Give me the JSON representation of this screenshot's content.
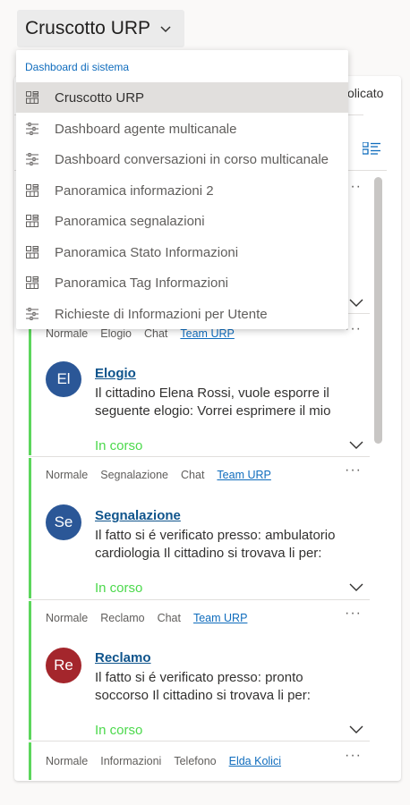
{
  "header": {
    "title": "Cruscotto URP"
  },
  "dropdown": {
    "section_label": "Dashboard di sistema",
    "items": [
      {
        "label": "Cruscotto URP",
        "icon": "grid-dashboard-icon",
        "selected": true
      },
      {
        "label": "Dashboard agente multicanale",
        "icon": "interactive-dashboard-icon"
      },
      {
        "label": "Dashboard conversazioni in corso multicanale",
        "icon": "interactive-dashboard-icon"
      },
      {
        "label": "Panoramica informazioni 2",
        "icon": "grid-dashboard-icon"
      },
      {
        "label": "Panoramica segnalazioni",
        "icon": "grid-dashboard-icon"
      },
      {
        "label": "Panoramica Stato Informazioni",
        "icon": "grid-dashboard-icon"
      },
      {
        "label": "Panoramica Tag Informazioni",
        "icon": "grid-dashboard-icon"
      },
      {
        "label": "Richieste di Informazioni per Utente",
        "icon": "interactive-dashboard-icon"
      }
    ]
  },
  "background": {
    "partial_text": "olicato"
  },
  "cards": [
    {
      "meta": {
        "priority": "Normale",
        "type": "Elogio",
        "channel": "Chat",
        "owner": "Team URP"
      },
      "avatar": {
        "initials": "El",
        "color": "#2b5797"
      },
      "title": "Elogio",
      "description": "Il cittadino Elena Rossi, vuole esporre il seguente elogio: Vorrei esprimere il mio",
      "status": "In corso"
    },
    {
      "meta": {
        "priority": "Normale",
        "type": "Segnalazione",
        "channel": "Chat",
        "owner": "Team URP"
      },
      "avatar": {
        "initials": "Se",
        "color": "#2b5797"
      },
      "title": "Segnalazione",
      "description": "Il fatto si é verificato presso: ambulatorio cardiologia Il cittadino si trovava li per:",
      "status": "In corso"
    },
    {
      "meta": {
        "priority": "Normale",
        "type": "Reclamo",
        "channel": "Chat",
        "owner": "Team URP"
      },
      "avatar": {
        "initials": "Re",
        "color": "#a4262c"
      },
      "title": "Reclamo",
      "description": "Il fatto si é verificato presso: pronto soccorso Il cittadino si trovava li per:",
      "status": "In corso"
    },
    {
      "meta": {
        "priority": "Normale",
        "type": "Informazioni",
        "channel": "Telefono",
        "owner": "Elda Kolici"
      }
    }
  ],
  "colors": {
    "accent": "#0f6cbd",
    "status_green": "#4cd94c",
    "bar_green": "#5cd65c"
  }
}
